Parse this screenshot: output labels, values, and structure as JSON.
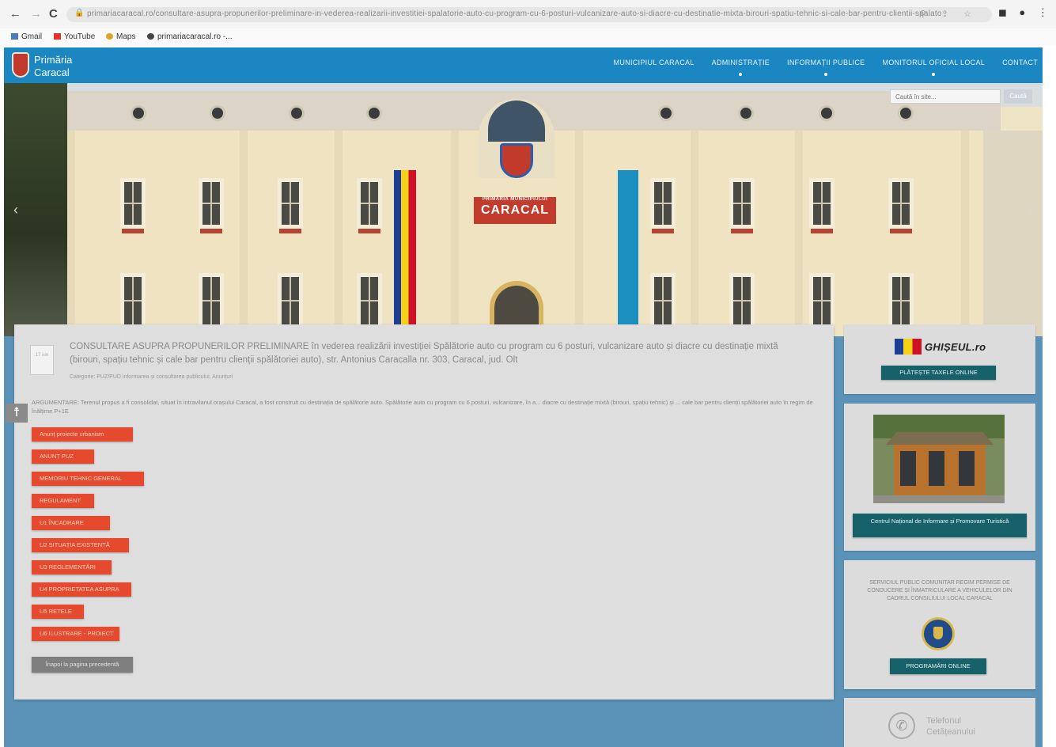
{
  "browser": {
    "back": "←",
    "forward": "→",
    "reload": "C",
    "url": "primariacaracal.ro/consultare-asupra-propunerilor-preliminare-in-vederea-realizarii-investitiei-spalatorie-auto-cu-program-cu-6-posturi-vulcanizare-auto-si-diacre-cu-destinatie-mixta-birouri-spatiu-tehnic-si-cale-bar-pentru-clientii-spalatoriei-auto",
    "bookmarks": [
      {
        "label": "Gmail",
        "color": "#4a78c2"
      },
      {
        "label": "YouTube",
        "color": "#e2322a"
      },
      {
        "label": "Maps",
        "color": "#e0a32a"
      },
      {
        "label": "primariacaracal.ro -...",
        "color": "#444444"
      }
    ]
  },
  "site": {
    "brand_line1": "Primăria",
    "brand_line2": "Caracal",
    "nav": [
      "Municipiul Caracal",
      "Administrație",
      "Informații publice",
      "Monitorul Oficial Local",
      "Contact"
    ],
    "search_placeholder": "Caută în site...",
    "search_button": "Caută",
    "city_sign_small": "PRIMĂRIA MUNICIPIULUI",
    "city_sign": "CARACAL"
  },
  "post": {
    "icon_text": "17 iun",
    "title": "CONSULTARE ASUPRA PROPUNERILOR PRELIMINARE în vederea realizării investiției Spălătorie auto cu program cu 6 posturi, vulcanizare auto și diacre cu destinație mixtă (birouri, spațiu tehnic și cale bar pentru clienții spălătoriei auto), str. Antonius Caracalla nr. 303, Caracal, jud. Olt",
    "category": "Categorie: PUZ/PUD informarea și consultarea publicului, Anunțuri",
    "summary": "ARGUMENTARE: Terenul propus a fi consolidat, situat în intravilanul orașului Caracal, a fost construit cu destinația de spălătorie auto. Spălătorie auto cu program cu 6 posturi, vulcanizare, în a... diacre cu destinație mixtă (birouri, spațiu tehnic) și ... cale bar pentru clienții spălătoriei auto în regim de înălțime P+1E",
    "tags": [
      "Anunț proiecte urbanism",
      "ANUNȚ PUZ",
      "MEMORIU TEHNIC GENERAL",
      "REGULAMENT",
      "U1 ÎNCADRARE",
      "U2 SITUAȚIA EXISTENTĂ",
      "U3 REGLEMENTĂRI",
      "U4 PROPRIETATEA ASUPRA",
      "U5 RETELE",
      "U6 ILUSTRARE - PROIECT"
    ],
    "back_button": "Înapoi la pagina precedentă"
  },
  "sidebar": {
    "ghiseul_name": "GHIȘEUL.ro",
    "ghiseul_button": "PLĂTEȘTE TAXELE ONLINE",
    "center_button": "Centrul Național de Informare și Promovare Turistică",
    "info_text": "SERVICIUL PUBLIC COMUNITAR REGIM PERMISE DE CONDUCERE ȘI ÎNMATRICULARE A VEHICULELOR DIN CADRUL CONSILIULUI LOCAL Caracal",
    "programari_button": "PROGRAMĂRI ONLINE",
    "phone_line1": "Telefonul",
    "phone_line2": "Cetățeanului"
  },
  "colors": {
    "header_blue": "#1a86c2",
    "tag_orange": "#e64a2e",
    "teal_button": "#17626a",
    "band_blue": "#5b93b8"
  },
  "icons": {
    "accessibility": "accessibility-icon",
    "phone": "phone-icon",
    "lock": "lock-icon"
  }
}
